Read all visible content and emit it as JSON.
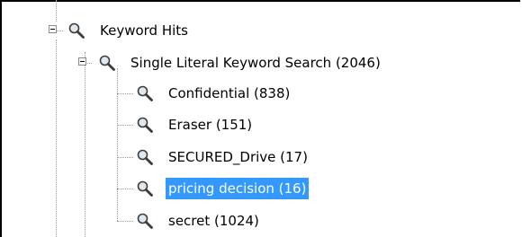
{
  "tree": {
    "root": {
      "label": "Keyword Hits",
      "icon": "magnifier-icon",
      "expanded": true
    },
    "group": {
      "label": "Single Literal Keyword Search (2046)",
      "icon": "magnifier-icon",
      "expanded": true
    },
    "items": [
      {
        "label": "Confidential (838)",
        "icon": "magnifier-icon",
        "selected": false
      },
      {
        "label": "Eraser (151)",
        "icon": "magnifier-icon",
        "selected": false
      },
      {
        "label": "SECURED_Drive (17)",
        "icon": "magnifier-icon",
        "selected": false
      },
      {
        "label": "pricing decision (16)",
        "icon": "magnifier-icon",
        "selected": true
      },
      {
        "label": "secret (1024)",
        "icon": "magnifier-icon",
        "selected": false
      }
    ]
  },
  "colors": {
    "selection": "#3399ff",
    "tree_lines": "#9a9a9a"
  }
}
